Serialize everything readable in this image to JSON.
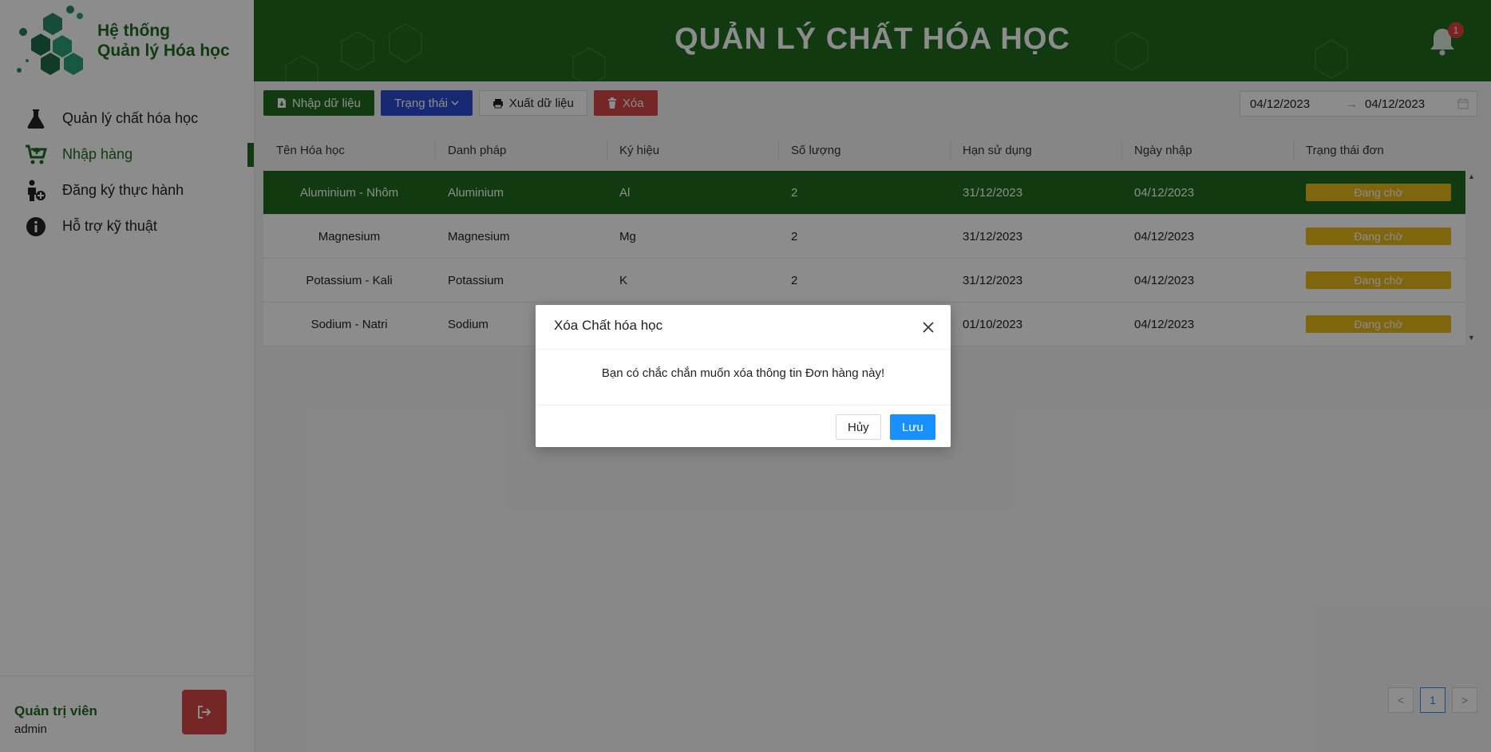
{
  "app": {
    "brand_line1": "Hệ thống",
    "brand_line2": "Quản lý Hóa học",
    "header_title": "QUẢN LÝ CHẤT HÓA HỌC",
    "notification_count": "1"
  },
  "sidebar": {
    "items": [
      {
        "label": "Quản lý chất hóa học",
        "icon": "flask-icon"
      },
      {
        "label": "Nhập hàng",
        "icon": "cart-icon",
        "active": true
      },
      {
        "label": "Đăng ký thực hành",
        "icon": "person-add-icon"
      },
      {
        "label": "Hỗ trợ kỹ thuật",
        "icon": "info-icon"
      }
    ],
    "user_role": "Quản trị viên",
    "user_name": "admin"
  },
  "toolbar": {
    "import_label": "Nhập dữ liệu",
    "status_label": "Trạng thái",
    "export_label": "Xuất dữ liệu",
    "delete_label": "Xóa",
    "date_from": "04/12/2023",
    "date_to": "04/12/2023",
    "date_sep": "→"
  },
  "table": {
    "headers": [
      "Tên Hóa học",
      "Danh pháp",
      "Ký hiệu",
      "Số lượng",
      "Hạn sử dụng",
      "Ngày nhập",
      "Trạng thái đơn"
    ],
    "rows": [
      {
        "name": "Aluminium - Nhôm",
        "nomenclature": "Aluminium",
        "symbol": "Al",
        "qty": "2",
        "expiry": "31/12/2023",
        "imported": "04/12/2023",
        "status": "Đang chờ"
      },
      {
        "name": "Magnesium",
        "nomenclature": "Magnesium",
        "symbol": "Mg",
        "qty": "2",
        "expiry": "31/12/2023",
        "imported": "04/12/2023",
        "status": "Đang chờ"
      },
      {
        "name": "Potassium - Kali",
        "nomenclature": "Potassium",
        "symbol": "K",
        "qty": "2",
        "expiry": "31/12/2023",
        "imported": "04/12/2023",
        "status": "Đang chờ"
      },
      {
        "name": "Sodium - Natri",
        "nomenclature": "Sodium",
        "symbol": "",
        "qty": "",
        "expiry": "01/10/2023",
        "imported": "04/12/2023",
        "status": "Đang chờ"
      }
    ]
  },
  "pagination": {
    "current": "1",
    "prev": "<",
    "next": ">"
  },
  "modal": {
    "title": "Xóa Chất hóa học",
    "message": "Bạn có chắc chắn muốn xóa thông tin Đơn hàng này!",
    "cancel_label": "Hủy",
    "ok_label": "Lưu"
  },
  "colors": {
    "primary": "#1f6b1f",
    "status_blue": "#2a4bd1",
    "danger": "#d64545",
    "pending": "#e8b81a",
    "accent": "#1890ff"
  }
}
